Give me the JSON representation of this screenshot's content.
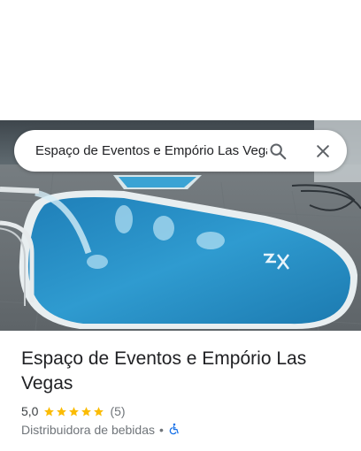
{
  "search": {
    "query": "Espaço de Eventos e Empório Las Vegas"
  },
  "icons": {
    "search": "search-icon",
    "close": "close-icon",
    "star": "star-icon",
    "accessibility": "wheelchair-icon"
  },
  "place": {
    "name": "Espaço de Eventos e Empório Las Vegas",
    "rating": "5,0",
    "stars": 5,
    "review_count": "(5)",
    "category": "Distribuidora de bebidas",
    "separator": "•"
  },
  "colors": {
    "star": "#fbbc04",
    "accessibility": "#1a73e8",
    "pool_water": "#2f9bd0"
  }
}
